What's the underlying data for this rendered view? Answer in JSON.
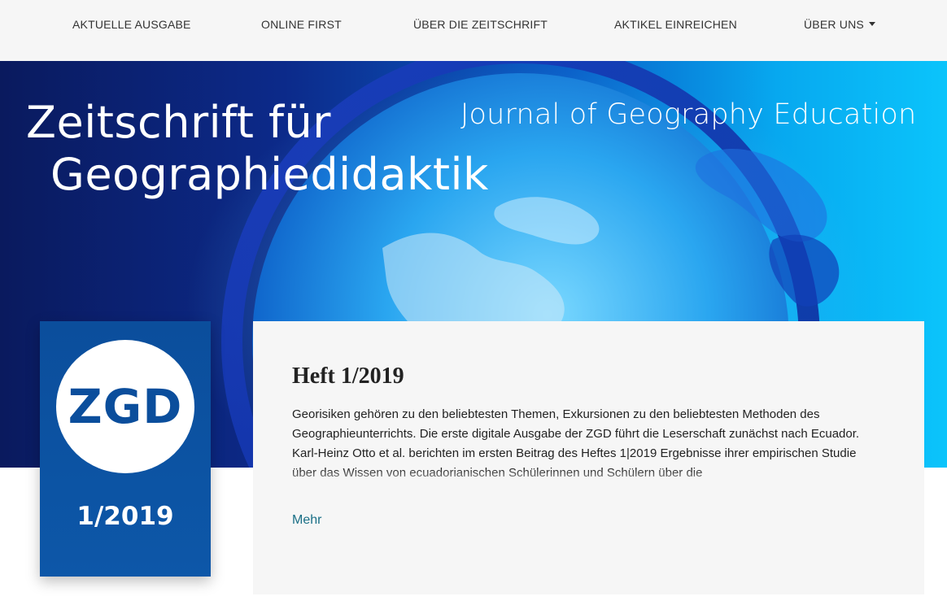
{
  "nav": {
    "items": [
      {
        "label": "AKTUELLE AUSGABE"
      },
      {
        "label": "ONLINE FIRST"
      },
      {
        "label": "ÜBER DIE ZEITSCHRIFT"
      },
      {
        "label": "AKTIKEL EINREICHEN"
      },
      {
        "label": "ÜBER UNS",
        "has_dropdown": true
      }
    ]
  },
  "hero": {
    "title_line1": "Zeitschrift für",
    "title_line2": "Geographiedidaktik",
    "subtitle": "Journal of Geography Education",
    "colors": {
      "dark": "#0a1a5e",
      "mid": "#0a5fc8",
      "light": "#0bc4fb"
    }
  },
  "cover": {
    "abbr": "ZGD",
    "issue": "1/2019",
    "color": "#0b4e9c"
  },
  "article": {
    "title": "Heft 1/2019",
    "body": "Georisiken gehören zu den beliebtesten Themen, Exkursionen zu den beliebtesten Methoden des Geographieunterrichts. Die erste digitale Ausgabe der ZGD führt die Leserschaft zunächst nach Ecuador. Karl-Heinz Otto et al. berichten im ersten Beitrag des Heftes 1|2019 Ergebnisse ihrer empirischen Studie über das Wissen von ecuadorianischen Schülerinnen und Schülern über die",
    "more_label": "Mehr",
    "link_color": "#1a6f86"
  }
}
